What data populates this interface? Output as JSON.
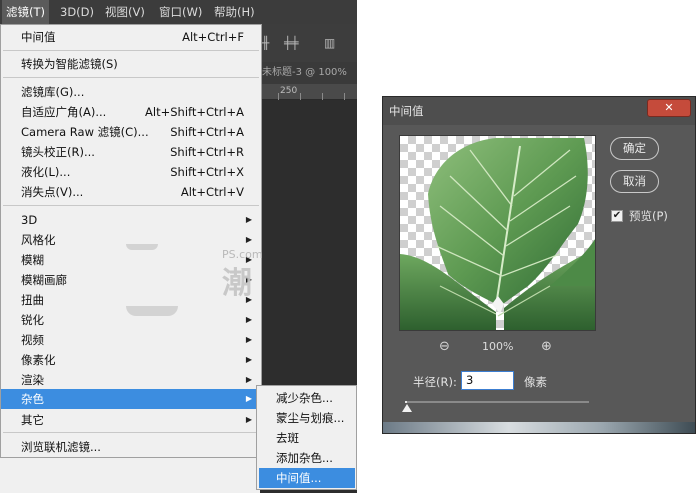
{
  "menubar": {
    "items": [
      "滤镜(T)",
      "3D(D)",
      "视图(V)",
      "窗口(W)",
      "帮助(H)"
    ]
  },
  "document": {
    "tab_title": "未标题-3 @ 100%",
    "ruler_label": "250"
  },
  "filter_menu": {
    "last_filter": {
      "label": "中间值",
      "shortcut": "Alt+Ctrl+F"
    },
    "convert_smart": "转换为智能滤镜(S)",
    "group1": [
      {
        "label": "滤镜库(G)...",
        "shortcut": ""
      },
      {
        "label": "自适应广角(A)...",
        "shortcut": "Alt+Shift+Ctrl+A"
      },
      {
        "label": "Camera Raw 滤镜(C)...",
        "shortcut": "Shift+Ctrl+A"
      },
      {
        "label": "镜头校正(R)...",
        "shortcut": "Shift+Ctrl+R"
      },
      {
        "label": "液化(L)...",
        "shortcut": "Shift+Ctrl+X"
      },
      {
        "label": "消失点(V)...",
        "shortcut": "Alt+Ctrl+V"
      }
    ],
    "group2": [
      "3D",
      "风格化",
      "模糊",
      "模糊画廊",
      "扭曲",
      "锐化",
      "视频",
      "像素化",
      "渲染",
      "杂色",
      "其它"
    ],
    "browse": "浏览联机滤镜..."
  },
  "noise_submenu": [
    "减少杂色...",
    "蒙尘与划痕...",
    "去斑",
    "添加杂色...",
    "中间值..."
  ],
  "watermark": {
    "text": "PS.com",
    "glyph": "潮"
  },
  "dialog": {
    "title": "中间值",
    "close_icon": "close-x-icon",
    "ok_label": "确定",
    "cancel_label": "取消",
    "preview_label": "预览(P)",
    "preview_checked": true,
    "zoom_out_icon": "zoom-out-icon",
    "zoom_in_icon": "zoom-in-icon",
    "zoom_level": "100%",
    "radius_label": "半径(R):",
    "radius_value": "3",
    "radius_unit": "像素",
    "radius_slider_fraction": 0.01
  },
  "colors": {
    "highlight": "#3c8de0",
    "dialog_bg": "#585858",
    "close_button": "#c54b3b",
    "menubar_bg": "#3c3c3c"
  }
}
